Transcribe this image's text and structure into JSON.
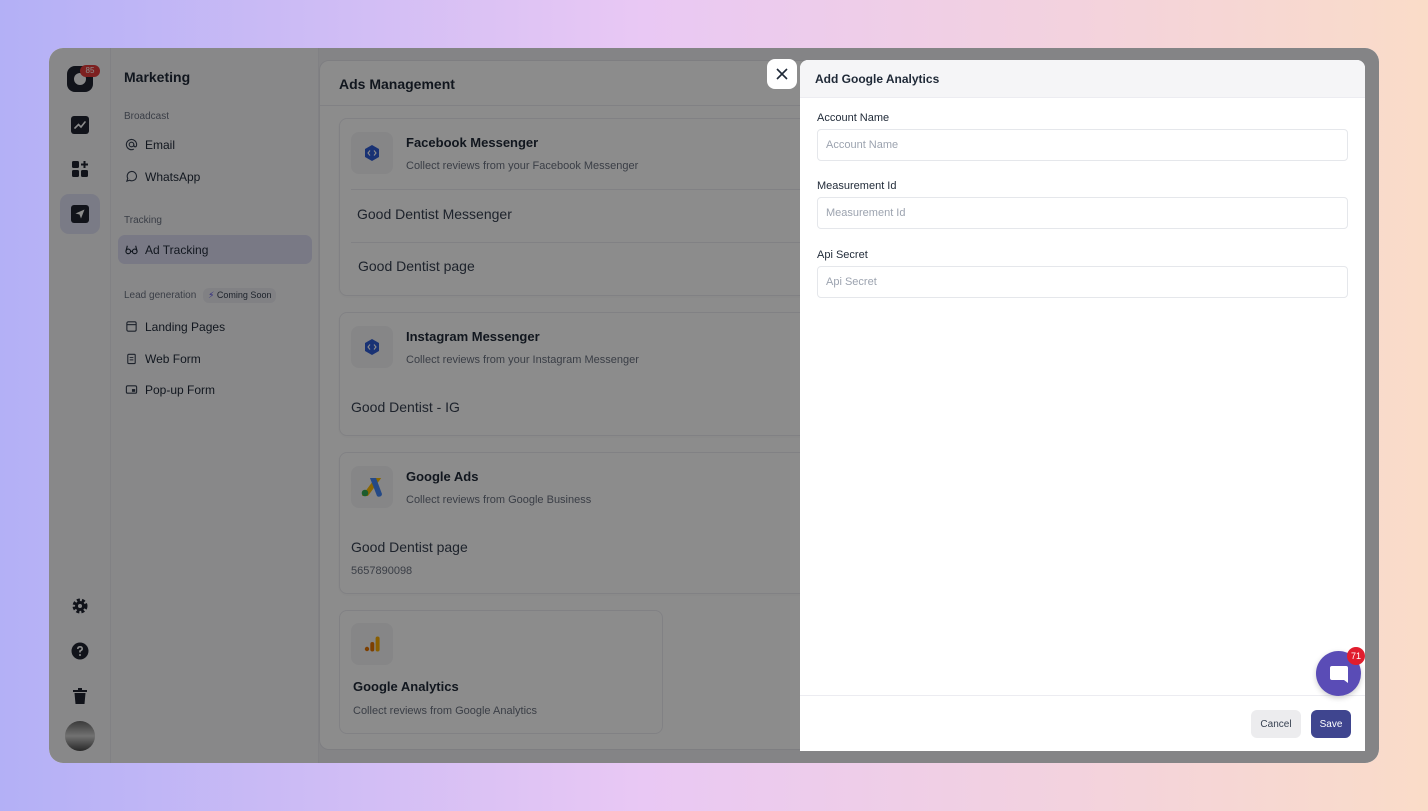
{
  "rail": {
    "notification_badge": "85",
    "icons": [
      "chart-line-icon",
      "dashboard-add-icon",
      "send-icon",
      "settings-icon",
      "help-icon",
      "trash-icon"
    ]
  },
  "subnav": {
    "title": "Marketing",
    "broadcast_label": "Broadcast",
    "email": "Email",
    "whatsapp": "WhatsApp",
    "tracking_label": "Tracking",
    "ad_tracking": "Ad Tracking",
    "lead_label": "Lead generation",
    "coming_soon": "Coming Soon",
    "landing_pages": "Landing Pages",
    "web_form": "Web Form",
    "popup_form": "Pop-up Form"
  },
  "main": {
    "title": "Ads Management",
    "facebook": {
      "name": "Facebook Messenger",
      "desc": "Collect reviews from your Facebook Messenger",
      "rows": [
        "Good Dentist Messenger",
        "Good Dentist page"
      ]
    },
    "instagram": {
      "name": "Instagram Messenger",
      "desc": "Collect reviews from your Instagram Messenger",
      "rows": [
        "Good Dentist - IG"
      ]
    },
    "google_ads": {
      "name": "Google Ads",
      "desc": "Collect reviews from Google Business",
      "row": "Good Dentist page",
      "row_sub": "5657890098"
    },
    "google_analytics": {
      "name": "Google Analytics",
      "desc": "Collect reviews from Google Analytics"
    }
  },
  "drawer": {
    "title": "Add Google Analytics",
    "fields": [
      {
        "label": "Account Name",
        "placeholder": "Account Name",
        "value": ""
      },
      {
        "label": "Measurement Id",
        "placeholder": "Measurement Id",
        "value": ""
      },
      {
        "label": "Api Secret",
        "placeholder": "Api Secret",
        "value": ""
      }
    ],
    "cancel": "Cancel",
    "save": "Save"
  },
  "chat": {
    "badge": "71"
  },
  "colors": {
    "accent": "#3f458f",
    "chat": "#5a4cb6",
    "badge": "#e11d2e"
  }
}
